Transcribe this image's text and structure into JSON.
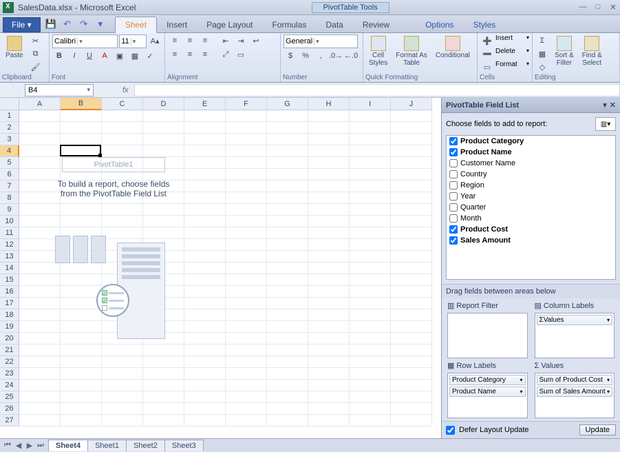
{
  "titlebar": {
    "filename": "SalesData.xlsx",
    "appname": "Microsoft Excel",
    "context_tool": "PivotTable Tools"
  },
  "tabs": {
    "file": "File",
    "items": [
      "Sheet",
      "Insert",
      "Page Layout",
      "Formulas",
      "Data",
      "Review"
    ],
    "context": [
      "Options",
      "Styles"
    ],
    "active": "Sheet"
  },
  "ribbon": {
    "groups": {
      "clipboard": {
        "label": "Clipboard",
        "paste": "Paste"
      },
      "font": {
        "label": "Font",
        "family": "Calibri",
        "size": "11"
      },
      "alignment": {
        "label": "Alignment"
      },
      "number": {
        "label": "Number",
        "format": "General"
      },
      "quick": {
        "label": "Quick Formatting",
        "cell_styles": "Cell\nStyles",
        "format_table": "Format As\nTable",
        "conditional": "Conditional"
      },
      "cells": {
        "label": "Cells",
        "insert": "Insert",
        "delete": "Delete",
        "format": "Format"
      },
      "editing": {
        "label": "Editing",
        "sort": "Sort &\nFilter",
        "find": "Find &\nSelect"
      }
    }
  },
  "namebox": "B4",
  "columns": [
    "A",
    "B",
    "C",
    "D",
    "E",
    "F",
    "G",
    "H",
    "I",
    "J"
  ],
  "rows": 27,
  "active_col": 1,
  "active_row": 3,
  "pivot_placeholder": {
    "title": "PivotTable1",
    "line1": "To build a report, choose fields",
    "line2": "from the PivotTable Field List"
  },
  "field_list": {
    "title": "PivotTable Field List",
    "prompt": "Choose fields to add to report:",
    "fields": [
      {
        "name": "Product Category",
        "checked": true
      },
      {
        "name": "Product Name",
        "checked": true
      },
      {
        "name": "Customer Name",
        "checked": false
      },
      {
        "name": "Country",
        "checked": false
      },
      {
        "name": "Region",
        "checked": false
      },
      {
        "name": "Year",
        "checked": false
      },
      {
        "name": "Quarter",
        "checked": false
      },
      {
        "name": "Month",
        "checked": false
      },
      {
        "name": "Product Cost",
        "checked": true
      },
      {
        "name": "Sales Amount",
        "checked": true
      }
    ],
    "drag_prompt": "Drag fields between areas below",
    "areas": {
      "filter_label": "Report Filter",
      "columns_label": "Column Labels",
      "rows_label": "Row Labels",
      "values_label": "Values",
      "columns_items": [
        "Values"
      ],
      "rows_items": [
        "Product Category",
        "Product Name"
      ],
      "values_items": [
        "Sum of Product Cost",
        "Sum of Sales Amount"
      ]
    },
    "defer": "Defer Layout Update",
    "update": "Update"
  },
  "sheet_tabs": {
    "items": [
      "Sheet4",
      "Sheet1",
      "Sheet2",
      "Sheet3"
    ],
    "active": "Sheet4"
  }
}
